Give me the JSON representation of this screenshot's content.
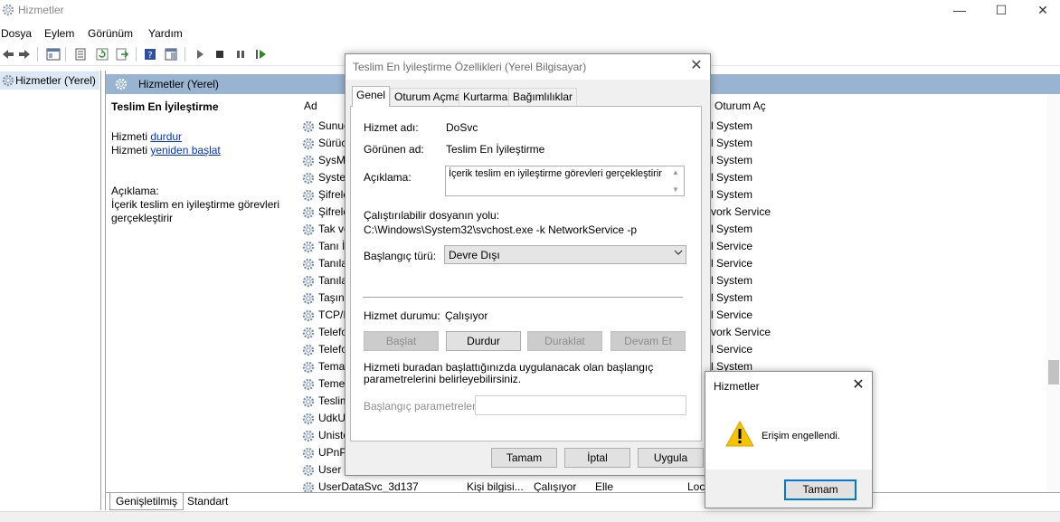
{
  "window": {
    "title": "Hizmetler"
  },
  "menu": {
    "items": [
      "Dosya",
      "Eylem",
      "Görünüm",
      "Yardım"
    ]
  },
  "tree": {
    "root": "Hizmetler (Yerel)"
  },
  "right_pane": {
    "header": "Hizmetler (Yerel)",
    "selected_service": "Teslim En İyileştirme",
    "action_prefix_1": "Hizmeti",
    "action_link_1": "durdur",
    "action_prefix_2": "Hizmeti",
    "action_link_2": "yeniden başlat",
    "description_label": "Açıklama:",
    "description": "İçerik teslim en iyileştirme görevleri gerçekleştirir"
  },
  "list": {
    "col_name": "Ad",
    "col_logon": "Oturum Aç",
    "rows": [
      {
        "name": "Sunuc",
        "logon": "l System"
      },
      {
        "name": "Sürüc",
        "logon": "l System"
      },
      {
        "name": "SysMa",
        "logon": "l System"
      },
      {
        "name": "Syste",
        "logon": "l System"
      },
      {
        "name": "Şifrele",
        "logon": "l System"
      },
      {
        "name": "Şifrele",
        "logon": "vork Service"
      },
      {
        "name": "Tak ve",
        "logon": "l System"
      },
      {
        "name": "Tanı İl",
        "logon": "l Service"
      },
      {
        "name": "Tanıla",
        "logon": "l Service"
      },
      {
        "name": "Tanıla",
        "logon": "l System"
      },
      {
        "name": "Taşına",
        "logon": "l System"
      },
      {
        "name": "TCP/IP",
        "logon": "l Service"
      },
      {
        "name": "Telefo",
        "logon": "vork Service"
      },
      {
        "name": "Telefo",
        "logon": "l Service"
      },
      {
        "name": "Tema",
        "logon": "l System"
      },
      {
        "name": "Teme",
        "logon": ""
      },
      {
        "name": "Teslim",
        "logon": ""
      },
      {
        "name": "UdkU",
        "logon": ""
      },
      {
        "name": "Uniste",
        "logon": ""
      },
      {
        "name": "UPnP",
        "logon": ""
      },
      {
        "name": "User E",
        "logon": ""
      }
    ],
    "last_row": {
      "name": "UserDataSvc_3d137",
      "description": "Kişi bilgisi...",
      "status": "Çalışıyor",
      "startup": "Elle",
      "logon": "Loc"
    }
  },
  "bottom_tabs": [
    "Genişletilmiş",
    "Standart"
  ],
  "properties": {
    "title": "Teslim En İyileştirme Özellikleri (Yerel Bilgisayar)",
    "tabs": [
      "Genel",
      "Oturum Açma",
      "Kurtarma",
      "Bağımlılıklar"
    ],
    "service_name_label": "Hizmet adı:",
    "service_name": "DoSvc",
    "display_name_label": "Görünen ad:",
    "display_name": "Teslim En İyileştirme",
    "description_label": "Açıklama:",
    "description": "İçerik teslim en iyileştirme görevleri gerçekleştirir",
    "path_label": "Çalıştırılabilir dosyanın yolu:",
    "path": "C:\\Windows\\System32\\svchost.exe -k NetworkService -p",
    "startup_label": "Başlangıç türü:",
    "startup_value": "Devre Dışı",
    "status_label": "Hizmet durumu:",
    "status_value": "Çalışıyor",
    "btn_start": "Başlat",
    "btn_stop": "Durdur",
    "btn_pause": "Duraklat",
    "btn_resume": "Devam Et",
    "params_note": "Hizmeti buradan başlattığınızda uygulanacak olan başlangıç parametrelerini belirleyebilirsiniz.",
    "params_label": "Başlangıç parametreleri:",
    "btn_ok": "Tamam",
    "btn_cancel": "İptal",
    "btn_apply": "Uygula"
  },
  "alert": {
    "title": "Hizmetler",
    "message": "Erişim engellendi.",
    "ok": "Tamam"
  }
}
